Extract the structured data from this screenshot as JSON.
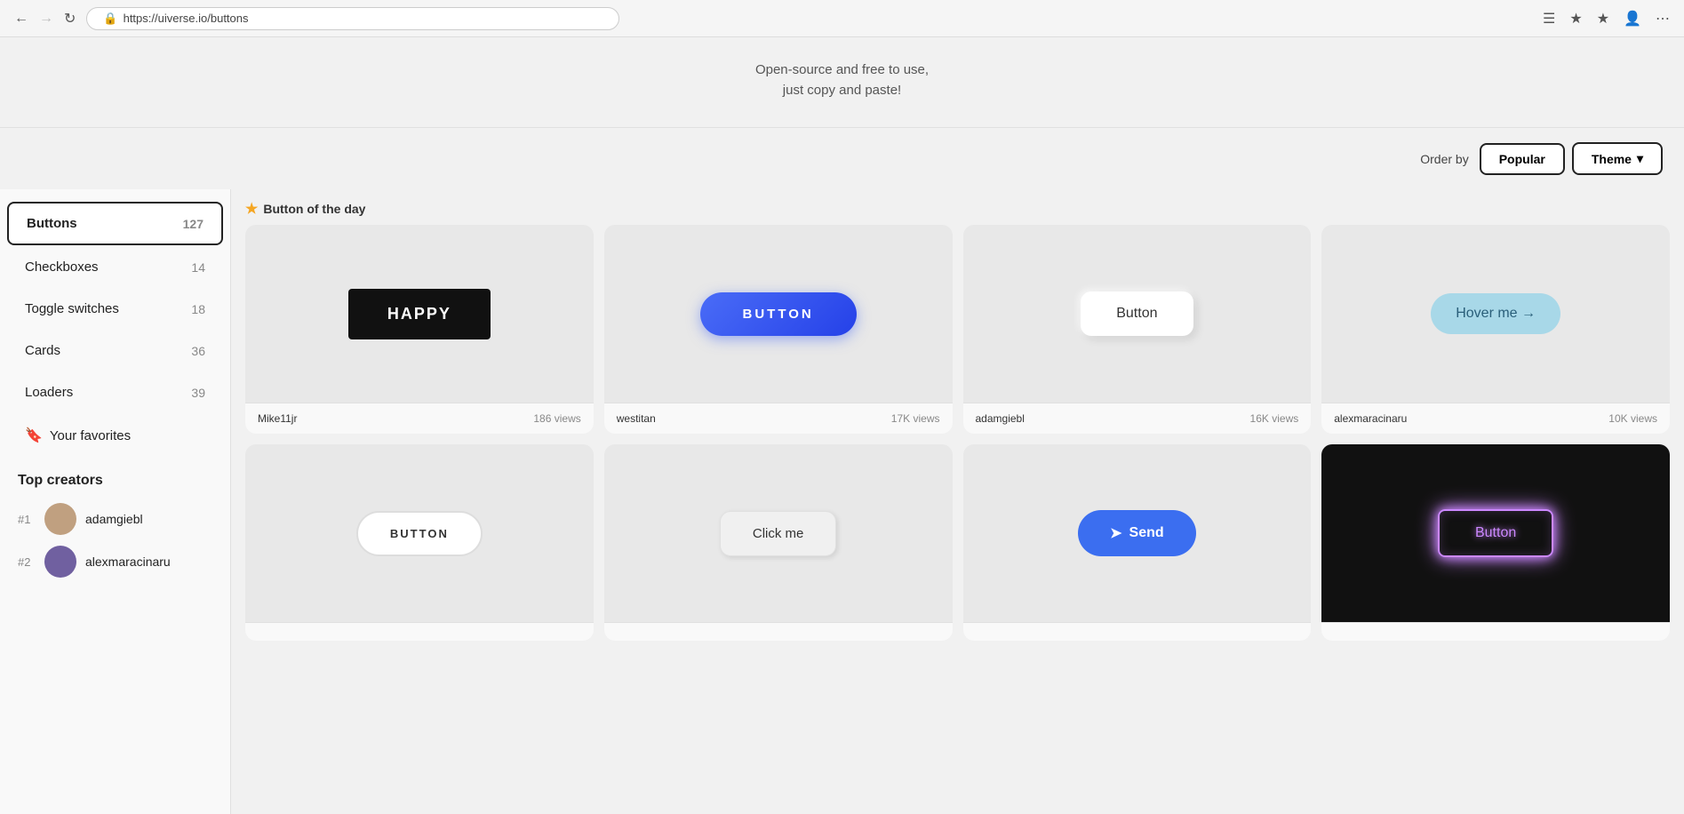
{
  "browser": {
    "url": "https://uiverse.io/buttons",
    "back_disabled": false,
    "forward_disabled": false
  },
  "hero": {
    "title": "Open-source and free to use,",
    "subtitle": "just copy and paste!"
  },
  "order_bar": {
    "label": "Order by",
    "popular_label": "Popular",
    "theme_label": "Theme",
    "chevron": "▾"
  },
  "sidebar": {
    "items": [
      {
        "label": "Buttons",
        "count": "127",
        "active": true
      },
      {
        "label": "Checkboxes",
        "count": "14",
        "active": false
      },
      {
        "label": "Toggle switches",
        "count": "18",
        "active": false
      },
      {
        "label": "Cards",
        "count": "36",
        "active": false
      },
      {
        "label": "Loaders",
        "count": "39",
        "active": false
      }
    ],
    "favorites_label": "Your favorites",
    "top_creators_title": "Top creators",
    "creators": [
      {
        "rank": "#1",
        "name": "adamgiebl"
      },
      {
        "rank": "#2",
        "name": "alexmaracinaru"
      }
    ]
  },
  "grid": {
    "botd_label": "Button of the day",
    "star": "★",
    "cards": [
      {
        "preview_type": "happy",
        "button_label": "HAPPY",
        "author": "Mike11jr",
        "views": "186 views"
      },
      {
        "preview_type": "button-blue",
        "button_label": "BUTTON",
        "author": "westitan",
        "views": "17K views"
      },
      {
        "preview_type": "button-soft",
        "button_label": "Button",
        "author": "adamgiebl",
        "views": "16K views"
      },
      {
        "preview_type": "hover-me",
        "button_label": "Hover me →",
        "author": "alexmaracinaru",
        "views": "10K views"
      },
      {
        "preview_type": "button-outline",
        "button_label": "BUTTON",
        "author": "",
        "views": ""
      },
      {
        "preview_type": "click-me",
        "button_label": "Click me",
        "author": "",
        "views": ""
      },
      {
        "preview_type": "send",
        "button_label": "Send",
        "author": "",
        "views": ""
      },
      {
        "preview_type": "neon",
        "button_label": "Button",
        "author": "",
        "views": ""
      }
    ]
  }
}
